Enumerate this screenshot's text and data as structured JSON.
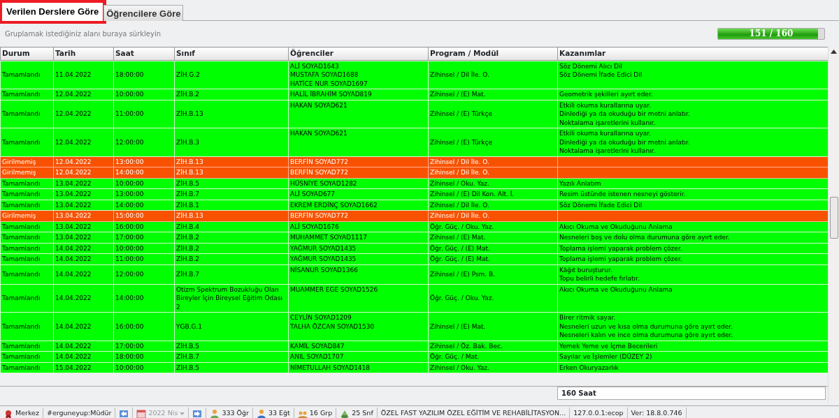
{
  "tabs": [
    {
      "label": "Verilen Derslere Göre",
      "selected": true,
      "highlighted": true
    },
    {
      "label": "Öğrencilere Göre",
      "selected": false,
      "highlighted": false
    }
  ],
  "group_panel": {
    "hint": "Gruplamak istediğiniz alanı buraya sürkleyin",
    "progress": {
      "label": "151 / 160",
      "level": 0.944
    }
  },
  "table": {
    "columns": [
      "Durum",
      "Tarih",
      "Saat",
      "Sınıf",
      "Öğrenciler",
      "Program / Modül",
      "Kazanımlar"
    ],
    "rows": [
      {
        "kind": "done",
        "cells": [
          "Tamamlandı",
          "11.04.2022",
          "18:00:00",
          "ZİH.G.2",
          "ALİ SOYAD1643\nMUSTAFA SOYAD1688\nHATİCE NUR SOYAD1697",
          "Zihinsel / Dil İle. O.",
          "Söz Dönemi Alıcı Dil\nSöz Dönemi İfade Edici Dil"
        ]
      },
      {
        "kind": "done",
        "cells": [
          "Tamamlandı",
          "12.04.2022",
          "10:00:00",
          "ZİH.B.2",
          "HALİL İBRAHİM SOYAD819",
          "Zihinsel / (E) Mat.",
          "Geometrik şekilleri ayırt eder."
        ]
      },
      {
        "kind": "done",
        "cells": [
          "Tamamlandı",
          "12.04.2022",
          "11:00:00",
          "ZİH.B.13",
          "HAKAN SOYAD621",
          "Zihinsel / (E) Türkçe",
          "Etkili okuma kurallarına uyar.\nDinlediği ya da okuduğu bir metni anlatır.\nNoktalama işaretlerini kullanır."
        ]
      },
      {
        "kind": "done",
        "cells": [
          "Tamamlandı",
          "12.04.2022",
          "12:00:00",
          "ZİH.B.3",
          "HAKAN SOYAD621",
          "Zihinsel / (E) Türkçe",
          "Etkili okuma kurallarına uyar.\nDinlediği ya da okuduğu bir metni anlatır.\nNoktalama işaretlerini kullanır."
        ]
      },
      {
        "kind": "missing",
        "cells": [
          "Girilmemiş",
          "12.04.2022",
          "13:00:00",
          "ZİH.B.13",
          "BERFİN SOYAD772",
          "Zihinsel / Dil İle. O.",
          ""
        ]
      },
      {
        "kind": "missing",
        "cells": [
          "Girilmemiş",
          "12.04.2022",
          "14:00:00",
          "ZİH.B.13",
          "BERFİN SOYAD772",
          "Zihinsel / Dil İle. O.",
          ""
        ]
      },
      {
        "kind": "done",
        "cells": [
          "Tamamlandı",
          "13.04.2022",
          "10:00:00",
          "ZİH.B.5",
          "HÜSNİYE SOYAD1282",
          "Zihinsel / Oku. Yaz.",
          "Yazılı Anlatım"
        ]
      },
      {
        "kind": "done",
        "cells": [
          "Tamamlandı",
          "13.04.2022",
          "13:00:00",
          "ZİH.B.7",
          "ALİ SOYAD677",
          "Zihinsel / (E) Dil Kon. Alt. İ.",
          "Resim üstünde istenen nesneyi gösterir."
        ]
      },
      {
        "kind": "done",
        "cells": [
          "Tamamlandı",
          "13.04.2022",
          "14:00:00",
          "ZİH.B.1",
          "EKREM ERDİNÇ SOYAD1662",
          "Zihinsel / Dil İle. O.",
          "Söz Dönemi İfade Edici Dil"
        ]
      },
      {
        "kind": "missing",
        "cells": [
          "Girilmemiş",
          "13.04.2022",
          "15:00:00",
          "ZİH.B.13",
          "BERFİN SOYAD772",
          "Zihinsel / Dil İle. O.",
          ""
        ]
      },
      {
        "kind": "done",
        "cells": [
          "Tamamlandı",
          "13.04.2022",
          "16:00:00",
          "ZİH.B.4",
          "ALİ SOYAD1676",
          "Öğr. Güç. / Oku. Yaz.",
          "Akıcı Okuma ve Okuduğunu Anlama"
        ]
      },
      {
        "kind": "done",
        "cells": [
          "Tamamlandı",
          "13.04.2022",
          "17:00:00",
          "ZİH.B.2",
          "MUHAMMET SOYAD1117",
          "Zihinsel / (E) Mat.",
          "Nesneleri boş ve dolu olma durumuna göre ayırt eder."
        ]
      },
      {
        "kind": "done",
        "cells": [
          "Tamamlandı",
          "14.04.2022",
          "10:00:00",
          "ZİH.B.2",
          "YAĞMUR SOYAD1435",
          "Öğr. Güç. / (E) Mat.",
          "Toplama işlemi yaparak problem çözer."
        ]
      },
      {
        "kind": "done",
        "cells": [
          "Tamamlandı",
          "14.04.2022",
          "11:00:00",
          "ZİH.B.2",
          "YAĞMUR SOYAD1435",
          "Öğr. Güç. / (E) Mat.",
          "Toplama işlemi yaparak problem çözer."
        ]
      },
      {
        "kind": "done",
        "cells": [
          "Tamamlandı",
          "14.04.2022",
          "12:00:00",
          "ZİH.B.7",
          "NİSANUR SOYAD1366",
          "Zihinsel / (E) Psm. B.",
          "Kâğıt buruşturur.\nTopu belirli hedefe fırlatır."
        ]
      },
      {
        "kind": "done",
        "cells": [
          "Tamamlandı",
          "14.04.2022",
          "14:00:00",
          "Otizm Spektrum Bozukluğu Olan\nBireyler İçin Bireysel Eğitim Odası 2",
          "MUAMMER EGE SOYAD1526",
          "Öğr. Güç. / Oku. Yaz.",
          "Akıcı Okuma ve Okuduğunu Anlama"
        ]
      },
      {
        "kind": "done",
        "cells": [
          "Tamamlandı",
          "14.04.2022",
          "16:00:00",
          "YGB.G.1",
          "CEYLİN SOYAD1209\nTALHA ÖZCAN SOYAD1530",
          "Zihinsel / (E) Mat.",
          "Birer ritmik sayar.\nNesneleri uzun ve kısa olma durumuna göre ayırt eder.\nNesneleri kalın ve ince olma durumuna göre ayırt eder."
        ]
      },
      {
        "kind": "done",
        "cells": [
          "Tamamlandı",
          "14.04.2022",
          "17:00:00",
          "ZİH.B.5",
          "KAMİL SOYAD847",
          "Zihinsel / Öz. Bak. Bec.",
          "Yemek Yeme ve İçme Becerileri"
        ]
      },
      {
        "kind": "done",
        "cells": [
          "Tamamlandı",
          "14.04.2022",
          "18:00:00",
          "ZİH.B.7",
          "ANIL SOYAD1707",
          "Öğr. Güç. / Mat.",
          "Sayılar ve İşlemler (DÜZEY 2)"
        ]
      },
      {
        "kind": "done",
        "cells": [
          "Tamamlandı",
          "15.04.2022",
          "10:00:00",
          "ZİH.B.5",
          "NİMETULLAH SOYAD1418",
          "Zihinsel / Oku. Yaz.",
          "Erken Okuryazarlık"
        ]
      }
    ],
    "summary": "160 Saat"
  },
  "status_bar": [
    {
      "text": "Merkez"
    },
    {
      "text": "#erguneyup:Müdür"
    },
    {
      "text": "2022 Nis",
      "disabled": true
    },
    {
      "text": "333 Öğr"
    },
    {
      "text": "33 Eğt"
    },
    {
      "text": "16 Grp"
    },
    {
      "text": "25 Snf"
    },
    {
      "text": "ÖZEL FAST YAZILIM ÖZEL EĞİTİM VE REHABİLİTASYON..."
    },
    {
      "text": "127.0.0.1:ecop"
    },
    {
      "text": "Ver: 18.8.0.746"
    }
  ]
}
